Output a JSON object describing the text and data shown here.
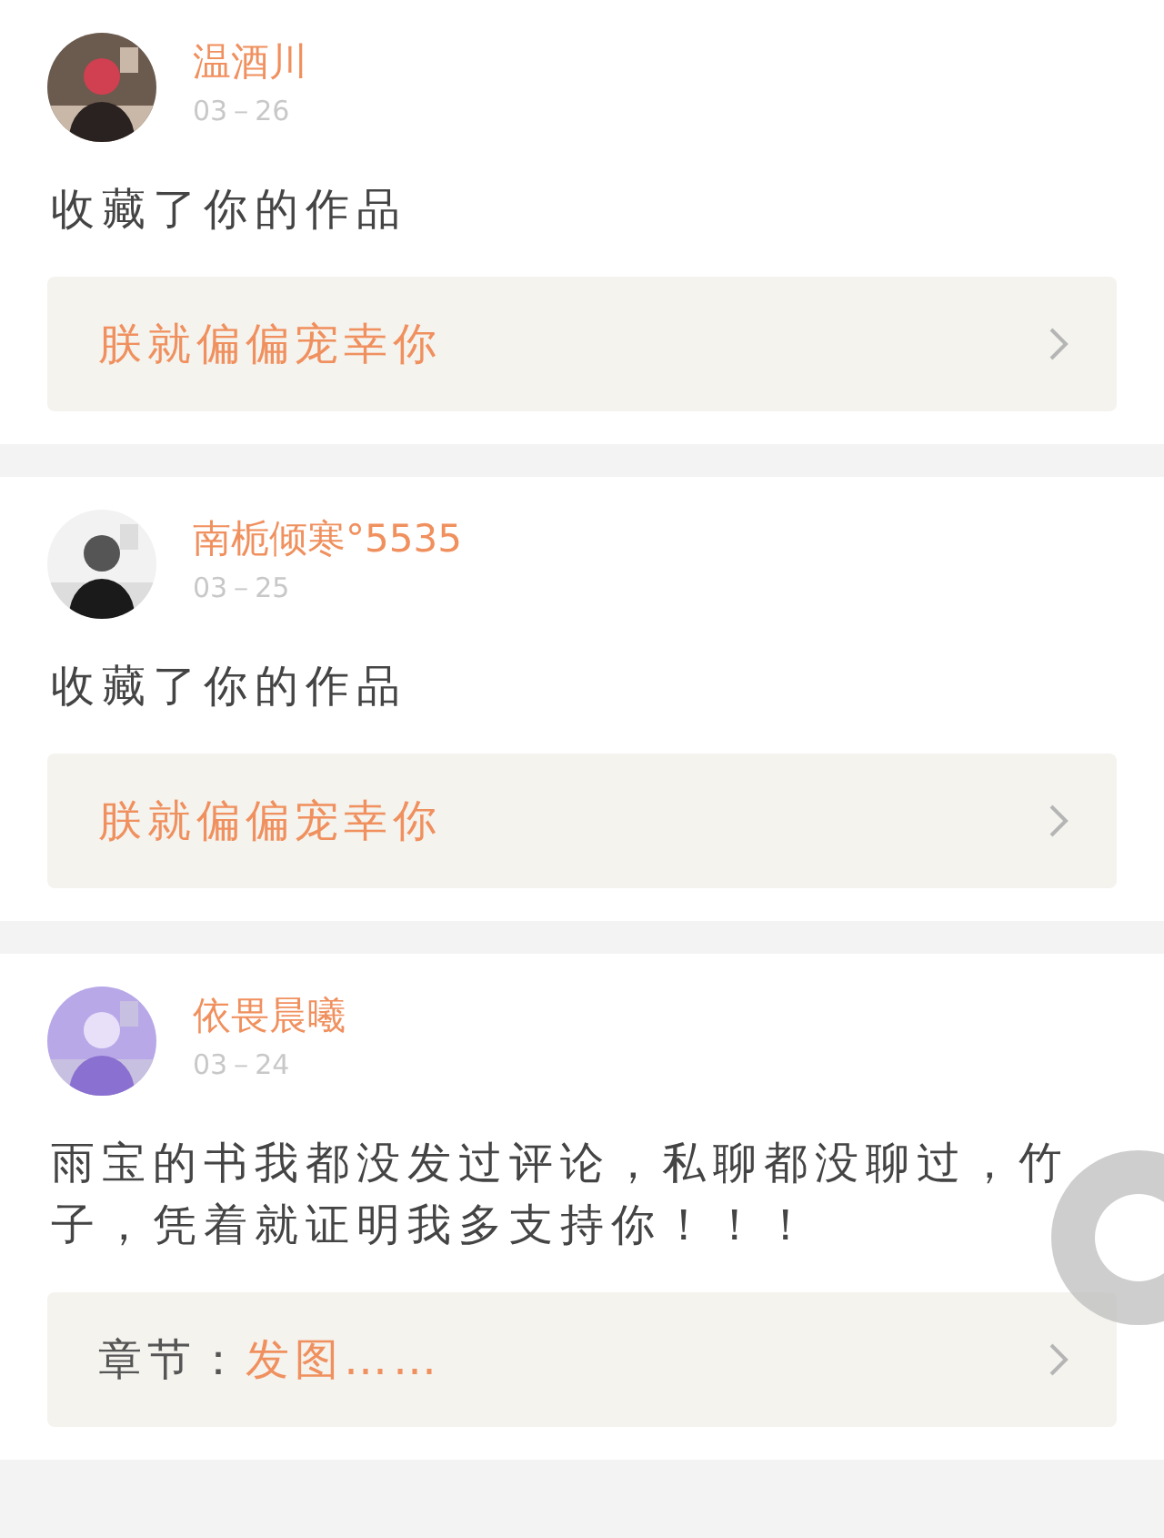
{
  "posts": [
    {
      "name": "温酒川",
      "date": "03－26",
      "message": "收藏了你的作品",
      "link": {
        "kind": "work",
        "title": "朕就偏偏宠幸你"
      }
    },
    {
      "name": "南栀倾寒°5535",
      "date": "03－25",
      "message": "收藏了你的作品",
      "link": {
        "kind": "work",
        "title": "朕就偏偏宠幸你"
      }
    },
    {
      "name": "依畏晨曦",
      "date": "03－24",
      "message": "雨宝的书我都没发过评论，私聊都没聊过，竹子，凭着就证明我多支持你！！！",
      "link": {
        "kind": "chapter",
        "label": "章节：",
        "title": "发图……"
      }
    }
  ]
}
